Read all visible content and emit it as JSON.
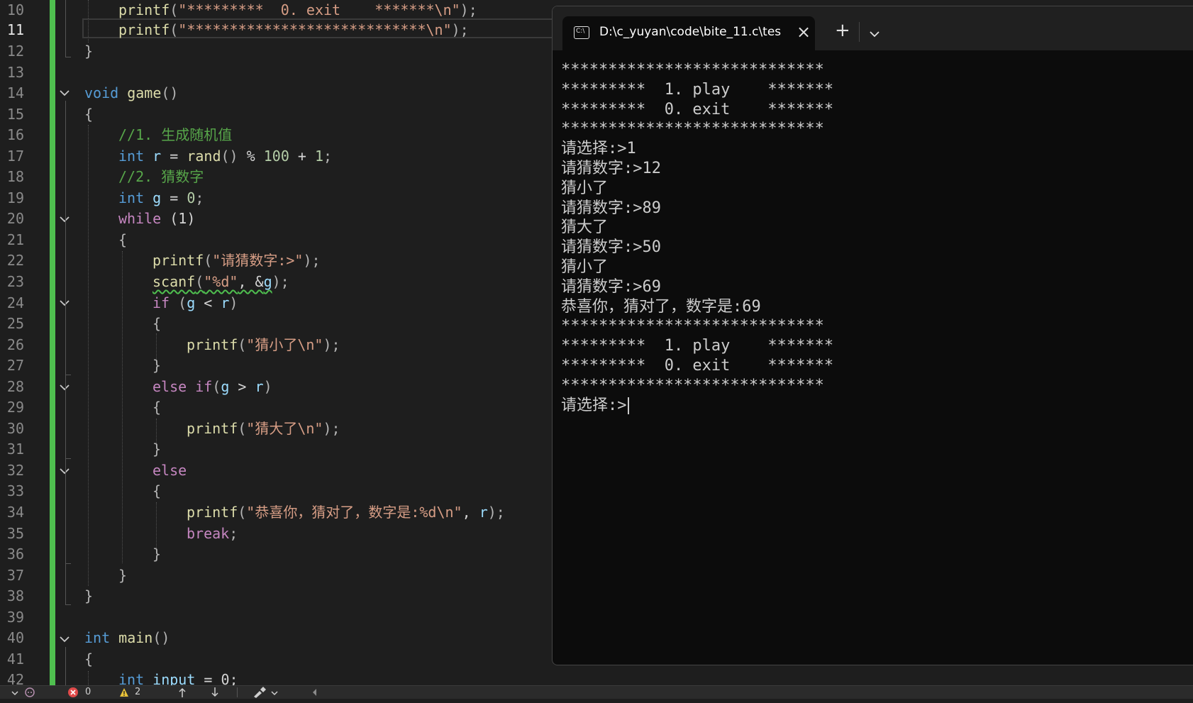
{
  "editor": {
    "active_line": "11",
    "line_numbers": [
      "10",
      "11",
      "12",
      "13",
      "14",
      "15",
      "16",
      "17",
      "18",
      "19",
      "20",
      "21",
      "22",
      "23",
      "24",
      "25",
      "26",
      "27",
      "28",
      "29",
      "30",
      "31",
      "32",
      "33",
      "34",
      "35",
      "36",
      "37",
      "38",
      "39",
      "40",
      "41",
      "42"
    ],
    "code": {
      "l10": {
        "fn": "printf",
        "open": "(",
        "str": "\"*********  0. exit    *******\\n\"",
        "close": ");"
      },
      "l11": {
        "fn": "printf",
        "open": "(",
        "str": "\"****************************\\n\"",
        "close": ");"
      },
      "l12": {
        "brace": "}"
      },
      "l14": {
        "kw": "void",
        "fn": "game",
        "paren": "()"
      },
      "l15": {
        "brace": "{"
      },
      "l16": {
        "comment": "//1. 生成随机值"
      },
      "l17": {
        "kw": "int",
        "var": "r",
        "eq": " = ",
        "fn": "rand",
        "paren": "()",
        "op": " % ",
        "num1": "100",
        "plus": " + ",
        "num2": "1",
        "semi": ";"
      },
      "l18": {
        "comment": "//2. 猜数字"
      },
      "l19": {
        "kw": "int",
        "var": "g",
        "eq": " = ",
        "num": "0",
        "semi": ";"
      },
      "l20": {
        "kw": "while",
        "cond": " (1)"
      },
      "l21": {
        "brace": "{"
      },
      "l22": {
        "fn": "printf",
        "open": "(",
        "str": "\"请猜数字:>\"",
        "close": ");"
      },
      "l23": {
        "fn": "scanf",
        "open": "(",
        "str": "\"%d\"",
        "comma": ", &",
        "var": "g",
        "close": ");"
      },
      "l24": {
        "kw": "if",
        "open": " (",
        "var1": "g",
        "op": " < ",
        "var2": "r",
        "close": ")"
      },
      "l25": {
        "brace": "{"
      },
      "l26": {
        "fn": "printf",
        "open": "(",
        "str": "\"猜小了\\n\"",
        "close": ");"
      },
      "l27": {
        "brace": "}"
      },
      "l28": {
        "kw": "else if",
        "open": "(",
        "var1": "g",
        "op": " > ",
        "var2": "r",
        "close": ")"
      },
      "l29": {
        "brace": "{"
      },
      "l30": {
        "fn": "printf",
        "open": "(",
        "str": "\"猜大了\\n\"",
        "close": ");"
      },
      "l31": {
        "brace": "}"
      },
      "l32": {
        "kw": "else"
      },
      "l33": {
        "brace": "{"
      },
      "l34": {
        "fn": "printf",
        "open": "(",
        "str": "\"恭喜你，猜对了，数字是:%d\\n\"",
        "comma": ", ",
        "var": "r",
        "close": ");"
      },
      "l35": {
        "kw": "break",
        "semi": ";"
      },
      "l36": {
        "brace": "}"
      },
      "l37": {
        "brace": "}"
      },
      "l38": {
        "brace": "}"
      },
      "l40": {
        "kw": "int",
        "fn": "main",
        "paren": "()"
      },
      "l41": {
        "brace": "{"
      },
      "l42": {
        "kw": "int",
        "var": "input",
        "rest": " = 0;"
      }
    }
  },
  "status_bar": {
    "errors": "0",
    "warnings": "2"
  },
  "terminal": {
    "tab_title": "D:\\c_yuyan\\code\\bite_11.c\\tes",
    "tab_icon_text": "C:\\",
    "lines": [
      "****************************",
      "*********  1. play    *******",
      "*********  0. exit    *******",
      "****************************",
      "请选择:>1",
      "请猜数字:>12",
      "猜小了",
      "请猜数字:>89",
      "猜大了",
      "请猜数字:>50",
      "猜小了",
      "请猜数字:>69",
      "恭喜你，猜对了，数字是:69",
      "****************************",
      "*********  1. play    *******",
      "*********  0. exit    *******",
      "****************************"
    ],
    "prompt": "请选择:>"
  },
  "colors": {
    "editor_bg": "#1e1e1e",
    "terminal_bg": "#0c0c0c",
    "change_bar": "#4fbf4f",
    "keyword": "#569cd6",
    "control_keyword": "#c586c0",
    "function": "#dcdcaa",
    "string": "#d69d85",
    "comment": "#57a64a"
  },
  "icons": {
    "fold": "chevron-down-icon",
    "tab": "terminal-icon",
    "close": "close-icon",
    "new_tab": "plus-icon",
    "dropdown": "chevron-down-icon"
  }
}
